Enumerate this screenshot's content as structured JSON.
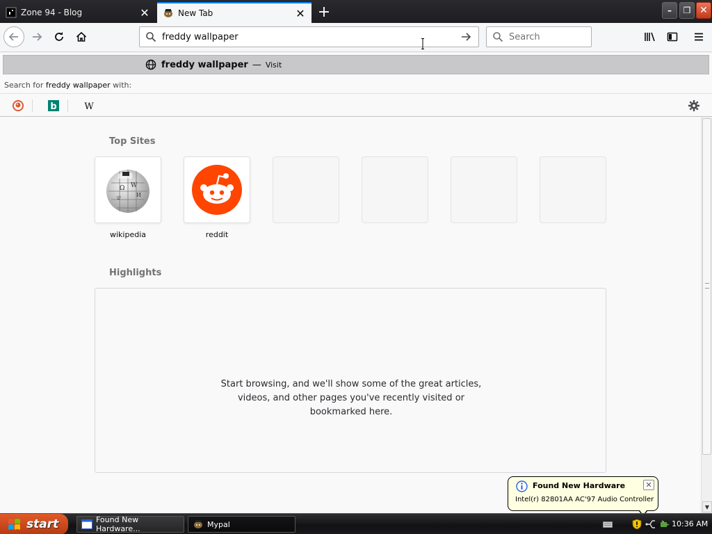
{
  "browser": {
    "tabs": [
      {
        "title": "Zone 94 - Blog",
        "active": false
      },
      {
        "title": "New Tab",
        "active": true
      }
    ],
    "window_controls": {
      "minimize": "–",
      "maximize": "❐",
      "close": "✕"
    },
    "urlbar": {
      "value": "freddy wallpaper"
    },
    "searchbar": {
      "placeholder": "Search"
    },
    "accent_color": "#0a84ff"
  },
  "dropdown": {
    "suggestion": {
      "text": "freddy wallpaper",
      "separator": "—",
      "action": "Visit"
    },
    "search_for": {
      "prefix": "Search for",
      "query": "freddy wallpaper",
      "suffix": "with:"
    },
    "engines": [
      {
        "name": "DuckDuckGo",
        "icon": "duckduckgo-icon"
      },
      {
        "name": "Bing",
        "icon": "bing-icon",
        "letter": "b"
      },
      {
        "name": "Wikipedia",
        "icon": "wikipedia-icon",
        "letter": "W"
      }
    ]
  },
  "newtab": {
    "topsites_title": "Top Sites",
    "topsites": [
      {
        "label": "wikipedia",
        "icon": "wikipedia-globe-icon"
      },
      {
        "label": "reddit",
        "icon": "reddit-icon",
        "color": "#ff4500"
      },
      {
        "label": ""
      },
      {
        "label": ""
      },
      {
        "label": ""
      },
      {
        "label": ""
      }
    ],
    "highlights_title": "Highlights",
    "highlights_lines": [
      "Start browsing, and we'll show some of the great articles,",
      "videos, and other pages you've recently visited or",
      "bookmarked here."
    ]
  },
  "balloon": {
    "title": "Found New Hardware",
    "text": "Intel(r) 82801AA AC'97 Audio Controller",
    "close": "✕"
  },
  "taskbar": {
    "start_label": "start",
    "tasks": [
      {
        "label": "Found New Hardware..."
      },
      {
        "label": "Mypal"
      }
    ],
    "clock": "10:36 AM"
  }
}
